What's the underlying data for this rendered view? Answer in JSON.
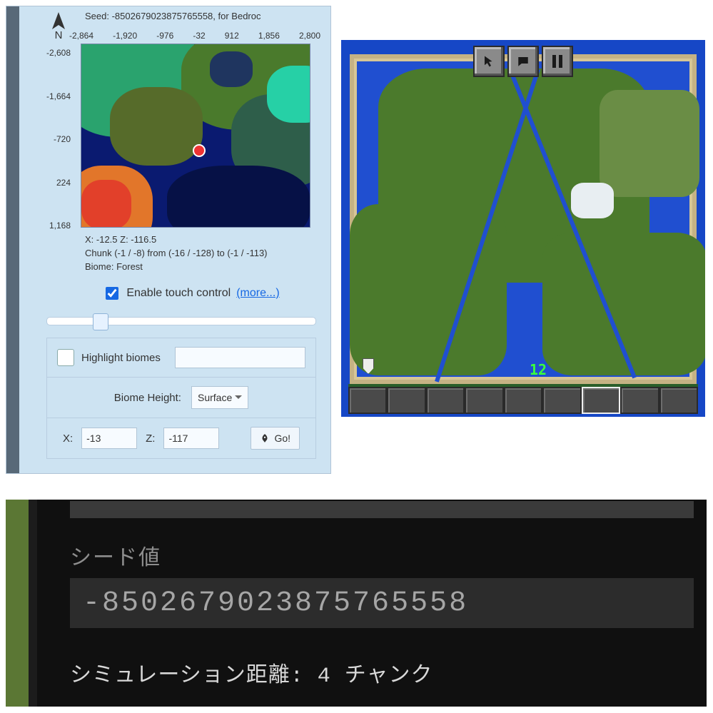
{
  "left": {
    "seed_text": "Seed: -8502679023875765558, for Bedroc",
    "compass_letter": "N",
    "x_ticks": [
      "-2,864",
      "-1,920",
      "-976",
      "-32",
      "912",
      "1,856",
      "2,800"
    ],
    "y_ticks": [
      "-2,608",
      "-1,664",
      "-720",
      "224",
      "1,168"
    ],
    "info_x_z": "X: -12.5   Z: -116.5",
    "info_chunk": "Chunk (-1 / -8) from (-16 / -128) to (-1 / -113)",
    "info_biome": "Biome: Forest",
    "touch_label": "Enable touch control",
    "touch_more": "(more...)",
    "highlight_label": "Highlight biomes",
    "biome_height_label": "Biome Height:",
    "biome_height_value": "Surface",
    "coord_x_label": "X:",
    "coord_x_value": "-13",
    "coord_z_label": "Z:",
    "coord_z_value": "-117",
    "go_label": "Go!"
  },
  "right": {
    "green_number": "12"
  },
  "bottom": {
    "label": "シード値",
    "seed_value": "-8502679023875765558",
    "sim_line": "シミュレーション距離: 4 チャンク"
  }
}
